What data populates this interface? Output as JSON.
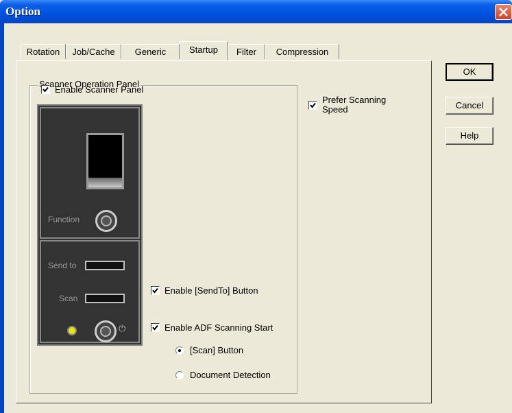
{
  "window": {
    "title": "Option"
  },
  "tabs": [
    {
      "label": "Rotation"
    },
    {
      "label": "Job/Cache"
    },
    {
      "label": "Generic"
    },
    {
      "label": "Startup"
    },
    {
      "label": "Filter"
    },
    {
      "label": "Compression"
    }
  ],
  "active_tab": "Startup",
  "buttons": {
    "ok": "OK",
    "cancel": "Cancel",
    "help": "Help"
  },
  "group": {
    "title": "Scanner Operation Panel"
  },
  "options": {
    "enable_scanner_panel": {
      "label": "Enable Scanner Panel",
      "checked": true
    },
    "prefer_scanning_speed": {
      "label_line1": "Prefer Scanning",
      "label_line2": "Speed",
      "checked": true
    },
    "enable_sendto": {
      "label": "Enable [SendTo] Button",
      "checked": true
    },
    "enable_adf": {
      "label": "Enable ADF Scanning Start",
      "checked": true
    },
    "radio_scan_button": {
      "label": "[Scan] Button",
      "selected": true
    },
    "radio_document_detection": {
      "label": "Document Detection",
      "selected": false
    }
  },
  "scanner_panel": {
    "function_label": "Function",
    "sendto_label": "Send to",
    "scan_label": "Scan",
    "power_symbol": "⏻"
  }
}
